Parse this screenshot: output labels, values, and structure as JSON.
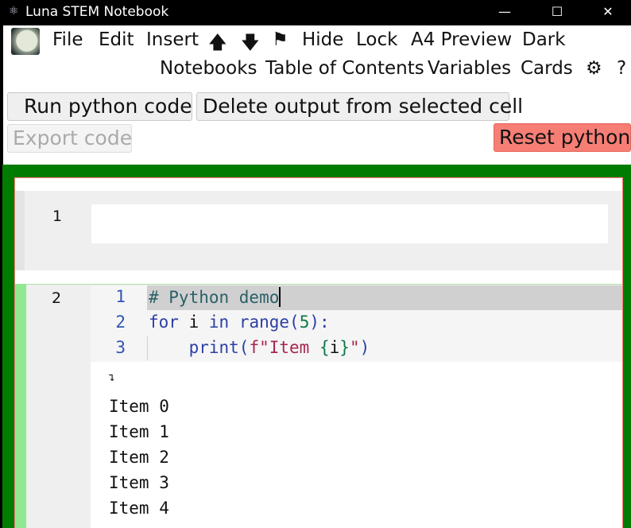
{
  "window": {
    "title": "Luna STEM Notebook",
    "icon": "atom-icon",
    "controls": {
      "minimize": "—",
      "maximize": "☐",
      "close": "✕"
    }
  },
  "menu": {
    "row1": [
      "File",
      "Edit",
      "Insert",
      "🡅",
      "🡇",
      "⚑",
      "Hide",
      "Lock",
      "A4 Preview",
      "Dark"
    ],
    "row2": [
      "Notebooks",
      "Table of Contents",
      "Variables",
      "Cards",
      "⚙",
      "?"
    ]
  },
  "toolbar": {
    "run": "Run python code",
    "delete_output": "Delete output from selected cell",
    "export": "Export code",
    "reset": "Reset python"
  },
  "cells": [
    {
      "number": "1",
      "content": ""
    },
    {
      "number": "2",
      "line_numbers": [
        "1",
        "2",
        "3"
      ],
      "code": {
        "line1": "# Python demo",
        "line2": {
          "kw1": "for",
          "var": " i ",
          "kw2": "in",
          "fn": " range",
          "open": "(",
          "num": "5",
          "close": "):"
        },
        "line3": {
          "indent": "    ",
          "fn": "print",
          "open": "(",
          "str1": "f\"Item ",
          "brace_open": "{",
          "var": "i",
          "brace_close": "}",
          "str2": "\"",
          "close": ")"
        }
      },
      "output_toggle": "↴",
      "output": [
        "Item 0",
        "Item 1",
        "Item 2",
        "Item 3",
        "Item 4"
      ]
    }
  ],
  "colors": {
    "frame": "#007c00",
    "reset_button": "#f67e75",
    "active_cell_bar": "#90e890",
    "line_numbers": "#2f55b5"
  }
}
